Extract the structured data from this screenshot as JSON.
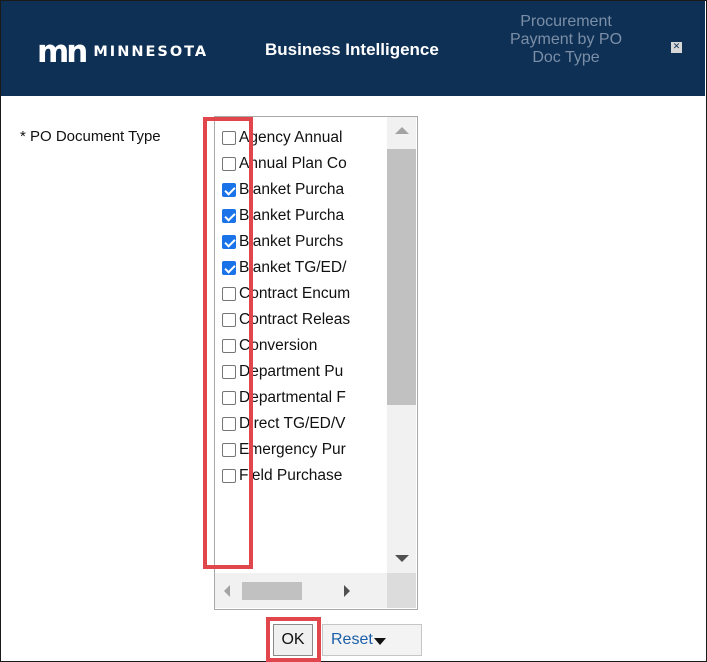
{
  "header": {
    "logo_mark": "mn",
    "logo_text": "MINNESOTA",
    "app_title": "Business Intelligence",
    "report_title": "Procurement Payment by PO Doc Type",
    "close_icon": "close-icon",
    "colors": {
      "background": "#0f3055",
      "text": "#ffffff",
      "report_title": "#7a8ea7"
    }
  },
  "filter": {
    "label": "* PO Document Type",
    "items": [
      {
        "label": "Agency Annual",
        "checked": false
      },
      {
        "label": "Annual Plan Co",
        "checked": false
      },
      {
        "label": "Blanket Purcha",
        "checked": true
      },
      {
        "label": "Blanket Purcha",
        "checked": true
      },
      {
        "label": "Blanket Purchs",
        "checked": true
      },
      {
        "label": "Blanket TG/ED/",
        "checked": true
      },
      {
        "label": "Contract Encum",
        "checked": false
      },
      {
        "label": "Contract Releas",
        "checked": false
      },
      {
        "label": "Conversion",
        "checked": false
      },
      {
        "label": "Department Pu",
        "checked": false
      },
      {
        "label": "Departmental F",
        "checked": false
      },
      {
        "label": "Direct TG/ED/V",
        "checked": false
      },
      {
        "label": "Emergency Pur",
        "checked": false
      },
      {
        "label": "Field Purchase",
        "checked": false
      }
    ],
    "checkbox_color": "#1a73e8",
    "highlight_color": "#e0464c"
  },
  "buttons": {
    "ok": "OK",
    "reset": "Reset"
  }
}
